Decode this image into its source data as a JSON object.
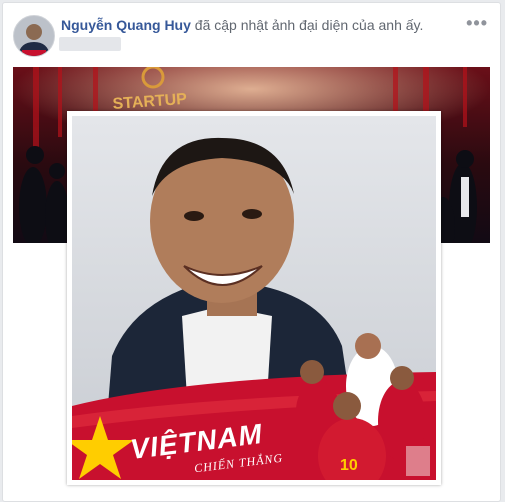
{
  "post": {
    "author_name": "Nguyễn Quang Huy",
    "action_text": "đã cập nhật ảnh đại diện của anh ấy.",
    "more_icon": "more-options-icon"
  },
  "profile_picture": {
    "banner_title": "VIỆTNAM",
    "banner_subtitle": "CHIẾN THẮNG",
    "jersey_number": "10"
  },
  "cover": {
    "sign_text": "STARTUP"
  },
  "colors": {
    "link_blue": "#365899",
    "banner_red": "#c8102e",
    "star_yellow": "#ffcd00",
    "meta_gray": "#616770"
  }
}
